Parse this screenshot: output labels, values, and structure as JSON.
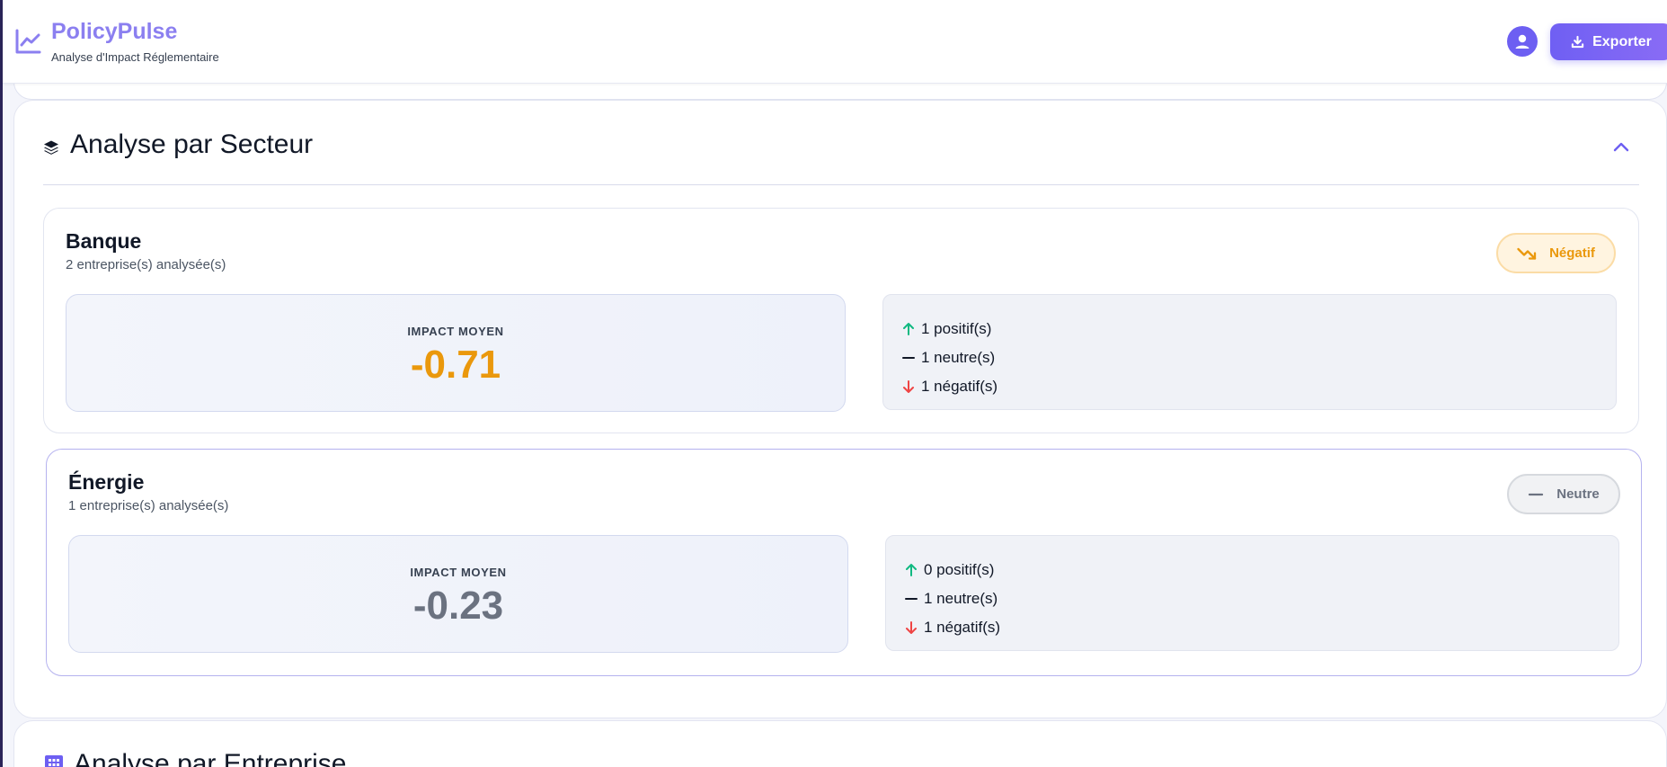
{
  "header": {
    "brand_name": "PolicyPulse",
    "brand_subtitle": "Analyse d'Impact Réglementaire",
    "export_label": "Exporter"
  },
  "sector_section": {
    "title": "Analyse par Secteur",
    "sectors": [
      {
        "name": "Banque",
        "count_text": "2 entreprise(s) analysée(s)",
        "badge_label": "Négatif",
        "badge_type": "negative",
        "impact_label": "IMPACT MOYEN",
        "impact_value": "-0.71",
        "impact_color": "#ea980c",
        "positive_text": "1 positif(s)",
        "neutral_text": "1 neutre(s)",
        "negative_text": "1 négatif(s)"
      },
      {
        "name": "Énergie",
        "count_text": "1 entreprise(s) analysée(s)",
        "badge_label": "Neutre",
        "badge_type": "neutral",
        "impact_label": "IMPACT MOYEN",
        "impact_value": "-0.23",
        "impact_color": "#6b7280",
        "positive_text": "0 positif(s)",
        "neutral_text": "1 neutre(s)",
        "negative_text": "1 négatif(s)"
      }
    ]
  },
  "company_section": {
    "title": "Analyse par Entreprise"
  },
  "colors": {
    "accent": "#6d5ff2",
    "positive": "#10b981",
    "negative": "#ef4444",
    "warning": "#ea980c"
  }
}
